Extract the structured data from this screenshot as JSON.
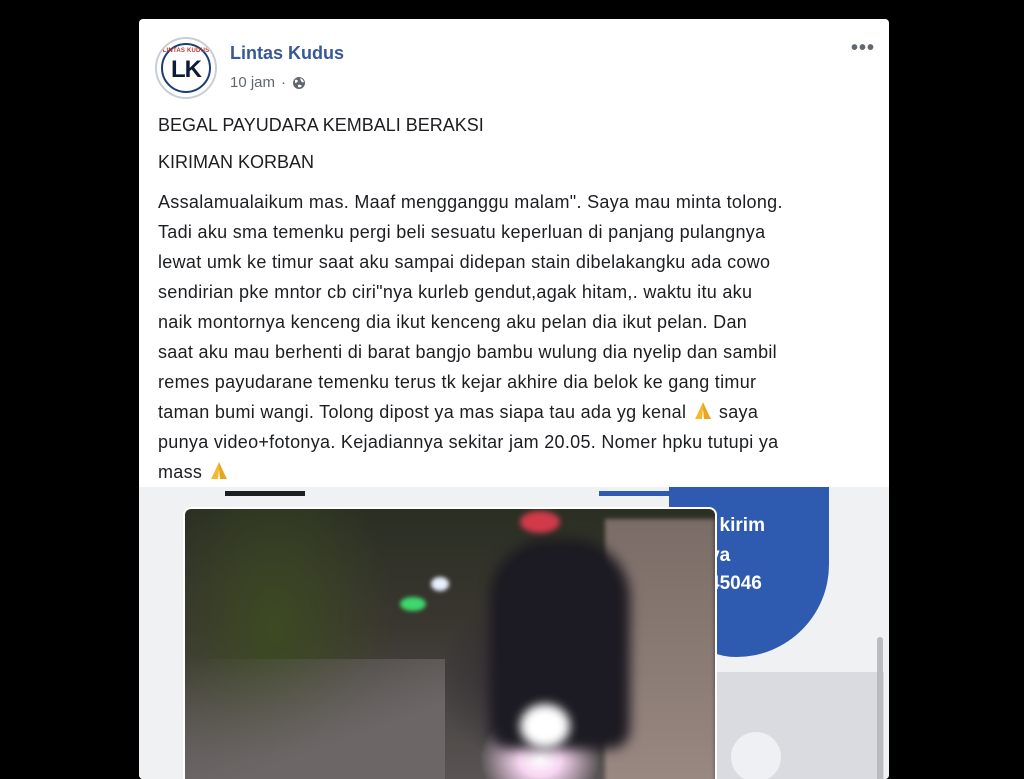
{
  "post": {
    "page_name": "Lintas Kudus",
    "avatar_small_text": "LINTAS KUDUS",
    "avatar_initials": "LK",
    "time": "10 jam",
    "separator": "·",
    "privacy_icon": "globe-icon",
    "more_icon": "more-options-icon",
    "more_label": "•••",
    "headline": "BEGAL PAYUDARA KEMBALI BERAKSI",
    "subheadline": "KIRIMAN KORBAN",
    "body_lines": [
      "Assalamualaikum mas. Maaf mengganggu malam\". Saya mau minta tolong.",
      "Tadi aku sma temenku pergi beli sesuatu keperluan di panjang pulangnya",
      "lewat umk ke timur saat aku sampai didepan stain dibelakangku ada cowo",
      "sendirian pke mntor cb ciri\"nya kurleb gendut,agak hitam,. waktu itu aku",
      "naik montornya kenceng dia ikut kenceng aku pelan dia ikut pelan. Dan",
      "saat aku mau berhenti di barat bangjo bambu wulung dia nyelip dan sambil",
      "remes payudarane temenku terus tk kejar akhire dia belok ke gang timur",
      "taman bumi wangi. Tolong dipost ya mas siapa tau ada yg kenal",
      "saya",
      "punya video+fotonya. Kejadiannya sekitar jam 20.05. Nomer hpku tutupi ya",
      "mass"
    ],
    "emoji_icon": "folded-hands-icon"
  },
  "media": {
    "ad_line1": "i kirim",
    "ad_line2": "va",
    "ad_line3": "45046",
    "accent_color": "#2e5bb0"
  },
  "colors": {
    "link": "#385898",
    "meta": "#606770",
    "text": "#1c1e21"
  }
}
